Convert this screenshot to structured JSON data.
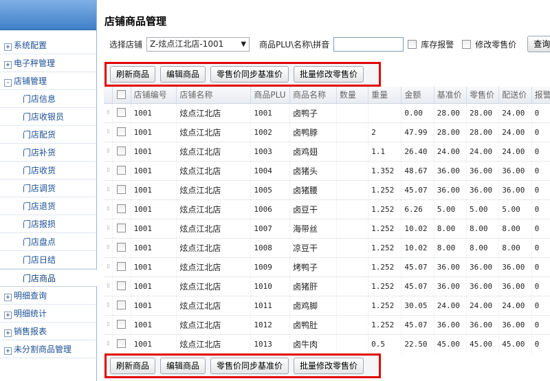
{
  "sidebar": {
    "items": [
      {
        "type": "group",
        "toggle": "+",
        "label": "系统配置"
      },
      {
        "type": "group",
        "toggle": "+",
        "label": "电子秤管理"
      },
      {
        "type": "group",
        "toggle": "-",
        "label": "店铺管理"
      },
      {
        "type": "child",
        "label": "门店信息"
      },
      {
        "type": "child",
        "label": "门店收银员"
      },
      {
        "type": "child",
        "label": "门店配货"
      },
      {
        "type": "child",
        "label": "门店补货"
      },
      {
        "type": "child",
        "label": "门店收货"
      },
      {
        "type": "child",
        "label": "门店调货"
      },
      {
        "type": "child",
        "label": "门店退货"
      },
      {
        "type": "child",
        "label": "门店报损"
      },
      {
        "type": "child",
        "label": "门店盘点"
      },
      {
        "type": "child",
        "label": "门店日结"
      },
      {
        "type": "active",
        "label": "门店商品"
      },
      {
        "type": "group",
        "toggle": "+",
        "label": "明细查询"
      },
      {
        "type": "group",
        "toggle": "+",
        "label": "明细统计"
      },
      {
        "type": "group",
        "toggle": "+",
        "label": "销售报表"
      },
      {
        "type": "group",
        "toggle": "+",
        "label": "未分割商品管理"
      }
    ]
  },
  "page": {
    "title": "店铺商品管理"
  },
  "filter": {
    "store_label": "选择店铺",
    "store_value": "Z-炫点江北店-1001",
    "search_label": "商品PLU\\名称\\拼音",
    "search_value": "",
    "stock_alert_label": "库存报警",
    "modify_price_label": "修改零售价",
    "query_label": "查询"
  },
  "toolbar": {
    "refresh": "刷新商品",
    "edit": "编辑商品",
    "sync_price": "零售价同步基准价",
    "batch_price": "批量修改零售价"
  },
  "table": {
    "columns": [
      "店铺编号",
      "店铺名称",
      "商品PLU",
      "商品名称",
      "数量",
      "重量",
      "金额",
      "基准价",
      "零售价",
      "配送价",
      "报警量"
    ],
    "rows": [
      [
        "1001",
        "炫点江北店",
        "1001",
        "卤鸭子",
        "",
        "",
        "0.00",
        "28.00",
        "28.00",
        "24.00",
        "0"
      ],
      [
        "1001",
        "炫点江北店",
        "1002",
        "卤鸭脖",
        "",
        "2",
        "47.99",
        "28.00",
        "28.00",
        "24.00",
        "0"
      ],
      [
        "1001",
        "炫点江北店",
        "1003",
        "卤鸡翅",
        "",
        "1.1",
        "26.40",
        "24.00",
        "24.00",
        "24.00",
        "0"
      ],
      [
        "1001",
        "炫点江北店",
        "1004",
        "卤猪头",
        "",
        "1.352",
        "48.67",
        "36.00",
        "36.00",
        "36.00",
        "0"
      ],
      [
        "1001",
        "炫点江北店",
        "1005",
        "卤猪腰",
        "",
        "1.252",
        "45.07",
        "36.00",
        "36.00",
        "36.00",
        "0"
      ],
      [
        "1001",
        "炫点江北店",
        "1006",
        "卤豆干",
        "",
        "1.252",
        "6.26",
        "5.00",
        "5.00",
        "5.00",
        "0"
      ],
      [
        "1001",
        "炫点江北店",
        "1007",
        "海带丝",
        "",
        "1.252",
        "10.02",
        "8.00",
        "8.00",
        "8.00",
        "0"
      ],
      [
        "1001",
        "炫点江北店",
        "1008",
        "凉豆干",
        "",
        "1.252",
        "10.02",
        "8.00",
        "8.00",
        "8.00",
        "0"
      ],
      [
        "1001",
        "炫点江北店",
        "1009",
        "烤鸭子",
        "",
        "1.252",
        "45.07",
        "36.00",
        "36.00",
        "36.00",
        "0"
      ],
      [
        "1001",
        "炫点江北店",
        "1010",
        "卤猪肝",
        "",
        "1.252",
        "45.07",
        "36.00",
        "36.00",
        "36.00",
        "0"
      ],
      [
        "1001",
        "炫点江北店",
        "1011",
        "卤鸡脚",
        "",
        "1.252",
        "30.05",
        "24.00",
        "24.00",
        "24.00",
        "0"
      ],
      [
        "1001",
        "炫点江北店",
        "1012",
        "卤鸭肚",
        "",
        "1.252",
        "45.07",
        "36.00",
        "36.00",
        "36.00",
        "0"
      ],
      [
        "1001",
        "炫点江北店",
        "1013",
        "卤牛肉",
        "",
        "0.5",
        "22.50",
        "45.00",
        "45.00",
        "45.00",
        "0"
      ]
    ]
  },
  "colors": {
    "highlight_border": "#e20000",
    "nav_text": "#1a4f96",
    "header_gradient": "#3f7fc8"
  }
}
